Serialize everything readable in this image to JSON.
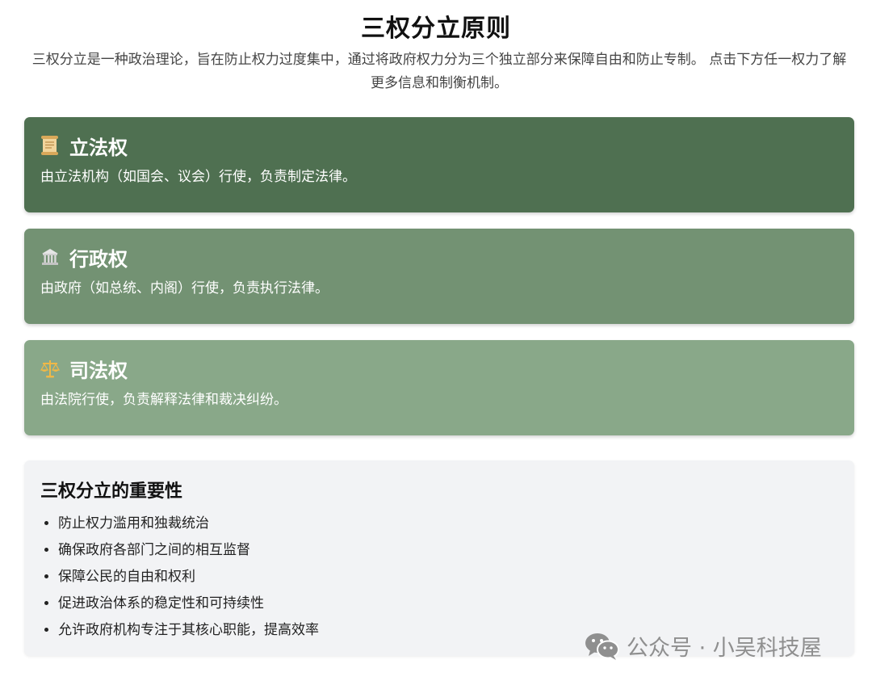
{
  "page": {
    "title": "三权分立原则",
    "intro": "三权分立是一种政治理论，旨在防止权力过度集中，通过将政府权力分为三个独立部分来保障自由和防止专制。 点击下方任一权力了解更多信息和制衡机制。"
  },
  "powers": [
    {
      "icon": "scroll-icon",
      "title": "立法权",
      "description": "由立法机构（如国会、议会）行使，负责制定法律。",
      "color": "#4f7051"
    },
    {
      "icon": "classical-building-icon",
      "title": "行政权",
      "description": "由政府（如总统、内阁）行使，负责执行法律。",
      "color": "#739273"
    },
    {
      "icon": "balance-scale-icon",
      "title": "司法权",
      "description": "由法院行使，负责解释法律和裁决纠纷。",
      "color": "#89a889"
    }
  ],
  "importance": {
    "title": "三权分立的重要性",
    "items": [
      "防止权力滥用和独裁统治",
      "确保政府各部门之间的相互监督",
      "保障公民的自由和权利",
      "促进政治体系的稳定性和可持续性",
      "允许政府机构专注于其核心职能，提高效率"
    ]
  },
  "watermark": {
    "icon": "wechat-icon",
    "text": "公众号 · 小吴科技屋"
  }
}
